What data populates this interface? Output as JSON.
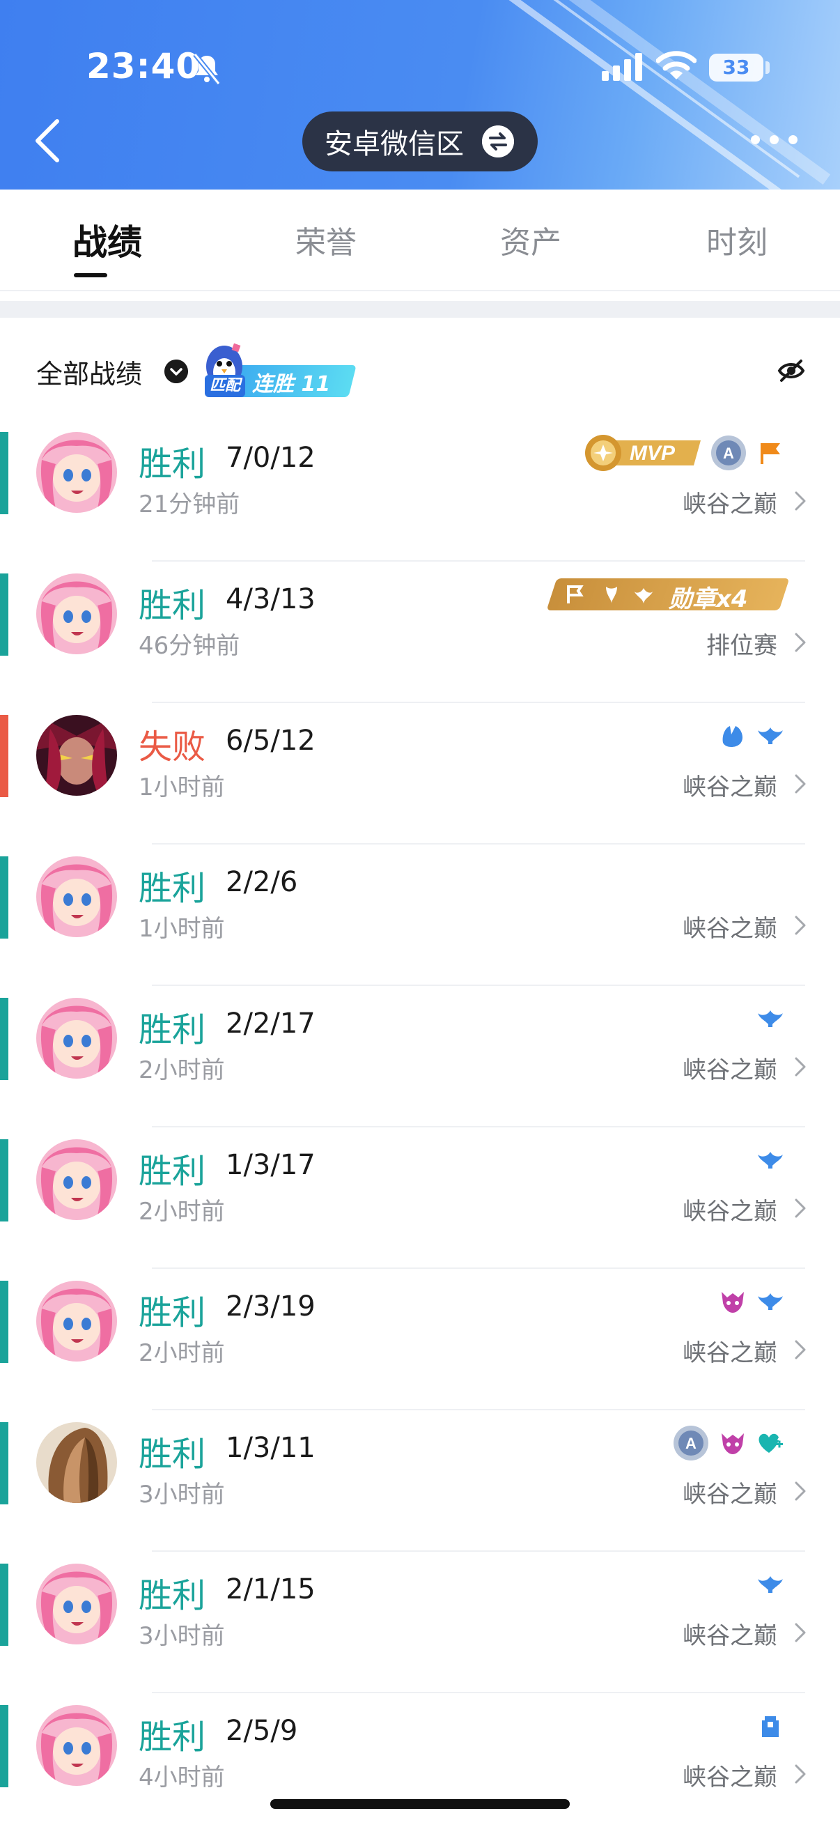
{
  "status_bar": {
    "time": "23:40",
    "battery": "33"
  },
  "header": {
    "server": "安卓微信区"
  },
  "tabs": [
    {
      "label": "战绩",
      "active": true
    },
    {
      "label": "荣誉",
      "active": false
    },
    {
      "label": "资产",
      "active": false
    },
    {
      "label": "时刻",
      "active": false
    }
  ],
  "filter": {
    "label": "全部战绩",
    "streak_tag": "匹配",
    "streak_text": "连胜 11"
  },
  "colors": {
    "win": "#1aa39a",
    "loss": "#ea5a45",
    "header": "#4a8cf2"
  },
  "matches": [
    {
      "result": "胜利",
      "kda": "7/0/12",
      "time": "21分钟前",
      "mode": "峡谷之巅",
      "outcome": "win",
      "hero": "pink-hair",
      "badges": [
        "mvp-badge",
        "a-grade-icon",
        "flag-icon"
      ]
    },
    {
      "result": "胜利",
      "kda": "4/3/13",
      "time": "46分钟前",
      "mode": "排位赛",
      "outcome": "win",
      "hero": "pink-hair",
      "badges": [
        "medal-strip"
      ],
      "medal_text": "勋章x4"
    },
    {
      "result": "失败",
      "kda": "6/5/12",
      "time": "1小时前",
      "mode": "峡谷之巅",
      "outcome": "loss",
      "hero": "dark-hero",
      "badges": [
        "hand-icon",
        "wing-icon"
      ]
    },
    {
      "result": "胜利",
      "kda": "2/2/6",
      "time": "1小时前",
      "mode": "峡谷之巅",
      "outcome": "win",
      "hero": "pink-hair",
      "badges": []
    },
    {
      "result": "胜利",
      "kda": "2/2/17",
      "time": "2小时前",
      "mode": "峡谷之巅",
      "outcome": "win",
      "hero": "pink-hair",
      "badges": [
        "wing-icon"
      ]
    },
    {
      "result": "胜利",
      "kda": "1/3/17",
      "time": "2小时前",
      "mode": "峡谷之巅",
      "outcome": "win",
      "hero": "pink-hair",
      "badges": [
        "wing-icon"
      ]
    },
    {
      "result": "胜利",
      "kda": "2/3/19",
      "time": "2小时前",
      "mode": "峡谷之巅",
      "outcome": "win",
      "hero": "pink-hair",
      "badges": [
        "demon-icon",
        "wing-icon"
      ]
    },
    {
      "result": "胜利",
      "kda": "1/3/11",
      "time": "3小时前",
      "mode": "峡谷之巅",
      "outcome": "win",
      "hero": "helmet-hero",
      "badges": [
        "a-grade-icon",
        "demon-icon",
        "heart-plus-icon"
      ]
    },
    {
      "result": "胜利",
      "kda": "2/1/15",
      "time": "3小时前",
      "mode": "峡谷之巅",
      "outcome": "win",
      "hero": "pink-hair",
      "badges": [
        "wing-icon"
      ]
    },
    {
      "result": "胜利",
      "kda": "2/5/9",
      "time": "4小时前",
      "mode": "峡谷之巅",
      "outcome": "win",
      "hero": "pink-hair",
      "badges": [
        "tower-icon"
      ]
    }
  ]
}
